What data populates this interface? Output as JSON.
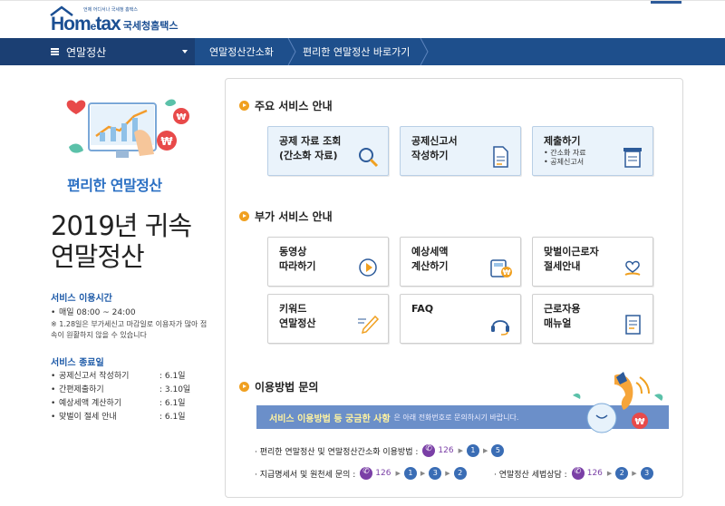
{
  "header": {
    "logo_small": "언제 어디서나 국세청 홈택스",
    "logo_home": "Hom",
    "logo_e": "e",
    "logo_tax": "tax",
    "logo_kr": "국세청홈택스"
  },
  "nav": {
    "main": "연말정산",
    "crumb1": "연말정산간소화",
    "crumb2": "편리한 연말정산 바로가기"
  },
  "left": {
    "promo": "편리한 연말정산",
    "title_line1": "2019년 귀속",
    "title_line2": "연말정산",
    "hours_heading": "서비스 이용시간",
    "hours_line": "매일 08:00 ~ 24:00",
    "hours_note": "※ 1.28일은 부가세신고 마감일로 이용자가 많아 접속이 원활하지 않을 수 있습니다",
    "end_heading": "서비스 종료일",
    "end_items": [
      {
        "label": "공제신고서 작성하기",
        "value": ": 6.1일"
      },
      {
        "label": "간편제출하기",
        "value": ": 3.10일"
      },
      {
        "label": "예상세액 계산하기",
        "value": ": 6.1일"
      },
      {
        "label": "맞벌이 절세 안내",
        "value": ": 6.1일"
      }
    ]
  },
  "main_services": {
    "title": "주요 서비스 안내",
    "cards": [
      {
        "title": "공제 자료 조회\n(간소화 자료)",
        "icon": "magnifier-icon"
      },
      {
        "title": "공제신고서\n작성하기",
        "icon": "document-icon"
      },
      {
        "title": "제출하기",
        "sub": "• 간소화 자료\n• 공제신고서",
        "icon": "submit-tray-icon"
      }
    ]
  },
  "extra_services": {
    "title": "부가 서비스 안내",
    "cards": [
      {
        "title": "동영상\n따라하기",
        "icon": "play-icon"
      },
      {
        "title": "예상세액\n계산하기",
        "icon": "calculator-won-icon"
      },
      {
        "title": "맞벌이근로자\n절세안내",
        "icon": "couple-heart-icon"
      },
      {
        "title": "키워드\n연말정산",
        "icon": "pencil-icon"
      },
      {
        "title": "FAQ",
        "icon": "headset-icon"
      },
      {
        "title": "근로자용\n매뉴얼",
        "icon": "manual-icon"
      }
    ]
  },
  "contact": {
    "title": "이용방법 문의",
    "banner_bold": "서비스 이용방법 등 궁금한 사항",
    "banner_rest": "은 아래 전화번호로 문의하시기 바랍니다.",
    "line1_label": "· 편리한 연말정산 및 연말정산간소화 이용방법 :",
    "line1_steps": [
      "1",
      "5"
    ],
    "line2_label": "· 지급명세서 및 원천세 문의 :",
    "line2_steps": [
      "1",
      "3",
      "2"
    ],
    "line3_label": "· 연말정산 세법상담 :",
    "line3_steps": [
      "2",
      "3"
    ],
    "phone": "126"
  }
}
